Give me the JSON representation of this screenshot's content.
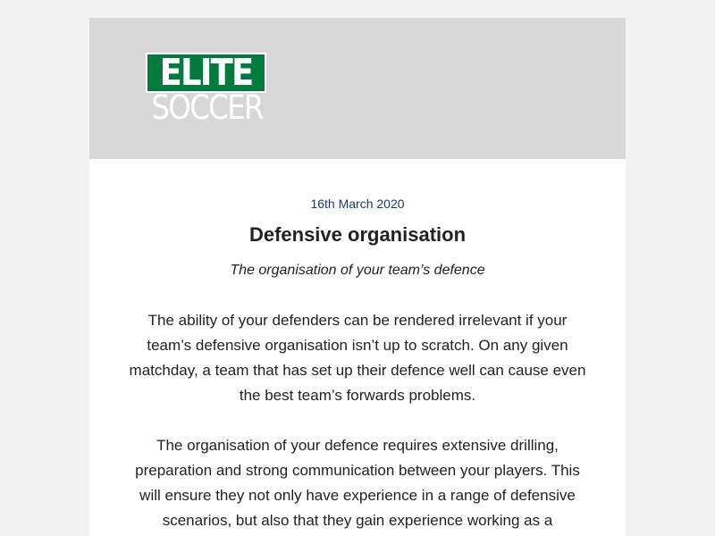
{
  "brand": {
    "logo_word_1": "ELITE",
    "logo_word_2": "SOCCER",
    "logo_green": "#007a3d",
    "header_bg": "#d7d7d7"
  },
  "article": {
    "date": "16th March 2020",
    "title": "Defensive organisation",
    "subtitle": "The organisation of your team’s defence",
    "paragraphs": [
      "The ability of your defenders can be rendered irrelevant if your team’s defensive organisation isn’t up to scratch. On any given matchday, a team that has set up their defence well can cause even the best team’s forwards problems.",
      "The organisation of your defence requires extensive drilling, preparation and strong communication between your players. This will ensure they not only have experience in a range of defensive scenarios, but also that they gain experience working as a"
    ],
    "date_color": "#1f3864"
  }
}
